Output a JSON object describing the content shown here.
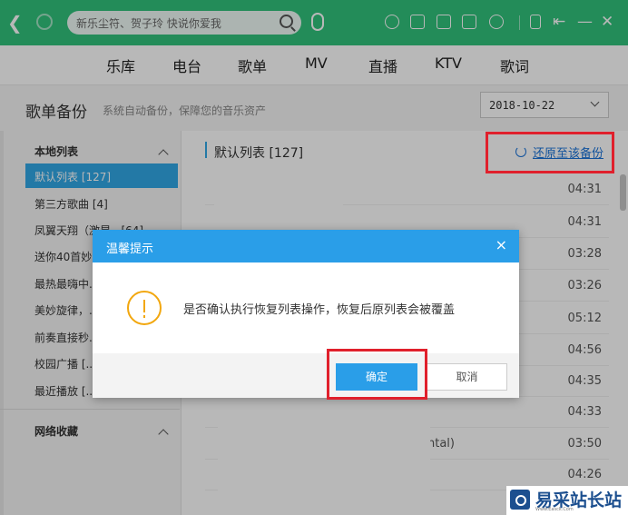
{
  "titlebar": {
    "search_placeholder": "新乐尘符、贺子玲 快说你爱我",
    "bg_color": "#31c27c"
  },
  "main_nav": [
    "乐库",
    "电台",
    "歌单",
    "MV",
    "直播",
    "KTV",
    "歌词"
  ],
  "page": {
    "title": "歌单备份",
    "subtitle": "系统自动备份，保障您的音乐资产",
    "date_selected": "2018-10-22"
  },
  "sidebar": {
    "local_header": "本地列表",
    "items": [
      "默认列表 [127]",
      "第三方歌曲 [4]",
      "凤翼天翔（激昂...[64]",
      "送你40首妙...",
      "最热最嗨中...",
      "美妙旋律，...",
      "前奏直接秒...",
      "校园广播 [...",
      "最近播放 [..."
    ],
    "net_header": "网络收藏"
  },
  "content": {
    "list_title": "默认列表 [127]",
    "restore_label": "还原至该备份",
    "durations": [
      "04:31",
      "04:31",
      "03:28",
      "03:26",
      "05:12",
      "04:56",
      "04:35",
      "04:33",
      "03:50",
      "04:26"
    ],
    "row_fragment": "ntal)"
  },
  "dialog": {
    "title": "温馨提示",
    "close": "×",
    "message": "是否确认执行恢复列表操作，恢复后原列表会被覆盖",
    "ok": "确定",
    "cancel": "取消",
    "accent_color": "#2a9ee8"
  },
  "watermark": {
    "text": "易采站长站",
    "sub": "Www.Easck.Com"
  }
}
